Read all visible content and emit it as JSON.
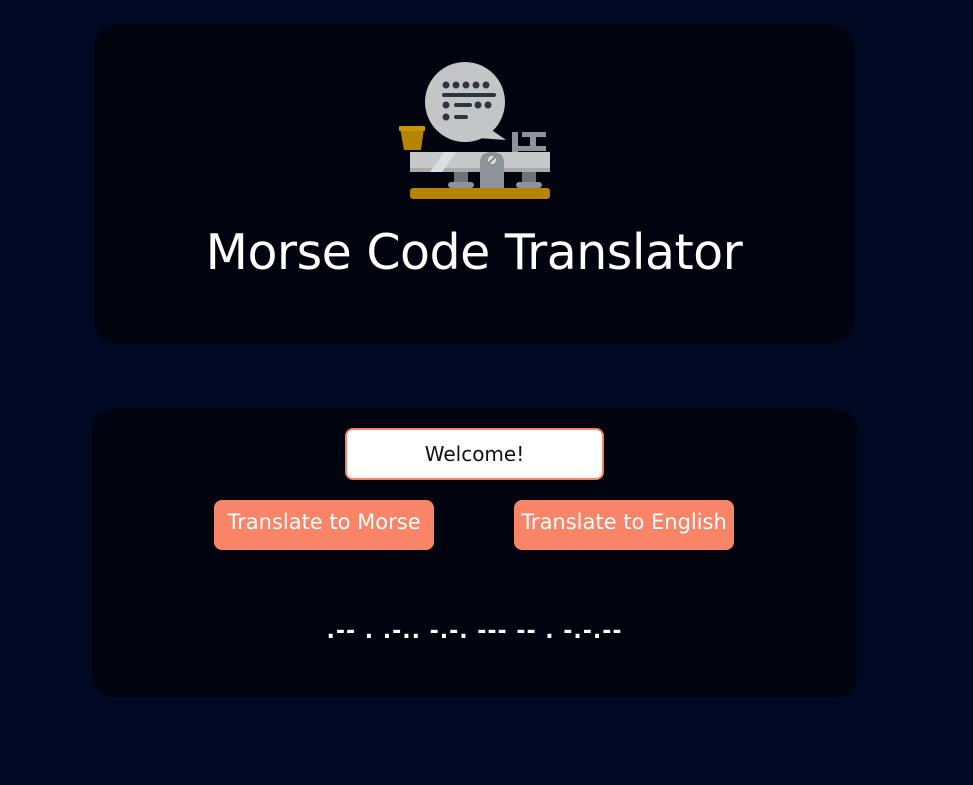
{
  "header": {
    "title": "Morse Code Translator",
    "logo_icon": "telegraph-key-with-speech-bubble-icon"
  },
  "translator": {
    "input_value": "Welcome!",
    "translate_to_morse_label": "Translate to Morse",
    "translate_to_english_label": "Translate to English",
    "output": ".-- . .-.. -.-. --- -- . -.-.--"
  },
  "colors": {
    "page_background": "#010824",
    "card_background": "#01040f",
    "accent": "#fa8468",
    "title_text": "#ffffff"
  }
}
